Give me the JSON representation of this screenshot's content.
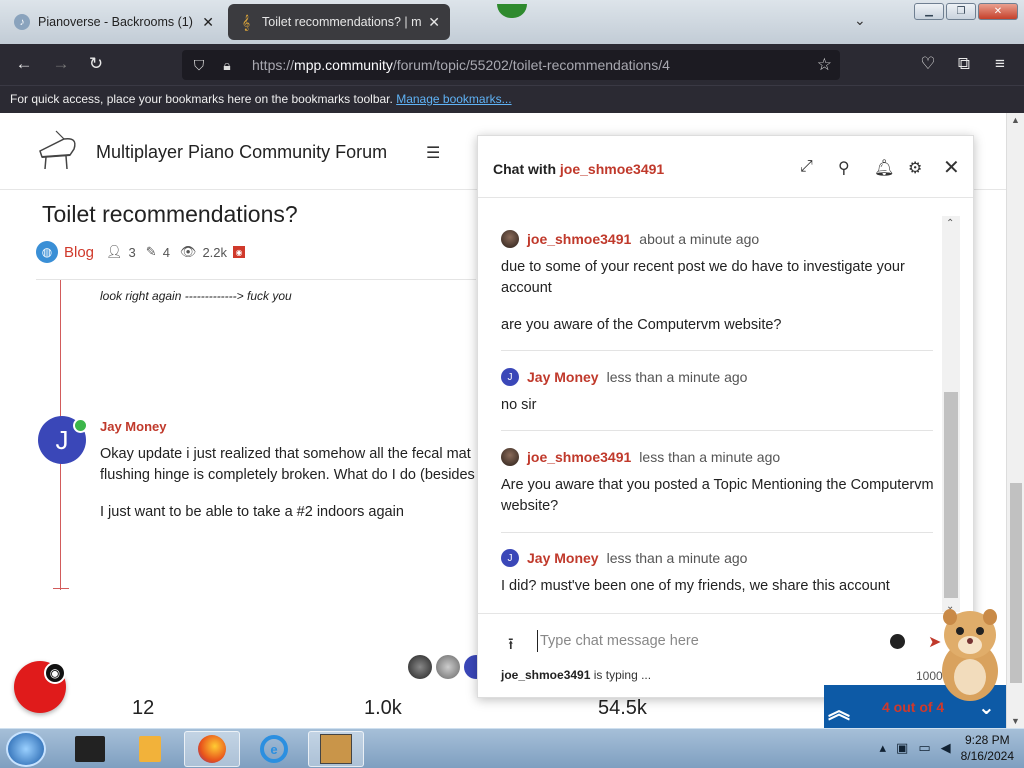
{
  "browser": {
    "tabs": [
      {
        "title": "Pianoverse - Backrooms (1)",
        "active": false
      },
      {
        "title": "Toilet recommendations? | mpp",
        "active": true
      }
    ],
    "url_prefix": "https://",
    "url_host": "mpp.community",
    "url_path": "/forum/topic/55202/toilet-recommendations/4",
    "bookmarks_text": "For quick access, place your bookmarks here on the bookmarks toolbar.",
    "bookmarks_link": "Manage bookmarks..."
  },
  "forum": {
    "site_title": "Multiplayer Piano Community Forum",
    "topic_title": "Toilet recommendations?",
    "category": "Blog",
    "posters": "3",
    "posts": "4",
    "views": "2.2k",
    "quote_text": "look right again -------------> fuck you",
    "post": {
      "author": "Jay Money",
      "avatar_letter": "J",
      "paragraphs": [
        "Okay update i just realized that somehow all the fecal mat",
        "flushing hinge is completely broken. What do I do (besides",
        "I just want to be able to take a #2 indoors again"
      ]
    },
    "stats": [
      "12",
      "1.0k",
      "54.5k"
    ],
    "pager_text": "4 out of 4"
  },
  "chat": {
    "title_prefix": "Chat with",
    "title_user": "joe_shmoe3491",
    "messages": [
      {
        "user": "joe_shmoe3491",
        "time": "about a minute ago",
        "paragraphs": [
          "due to some of your recent post we do have to investigate your account",
          "are you aware of the Computervm website?"
        ]
      },
      {
        "user": "Jay Money",
        "time": "less than a minute ago",
        "paragraphs": [
          "no sir"
        ]
      },
      {
        "user": "joe_shmoe3491",
        "time": "less than a minute ago",
        "paragraphs": [
          "Are you aware that you posted a Topic Mentioning the Computervm website?"
        ]
      },
      {
        "user": "Jay Money",
        "time": "less than a minute ago",
        "paragraphs": [
          "I did? must've been one of my friends, we share this account"
        ]
      }
    ],
    "input_placeholder": "Type chat message here",
    "typing_user": "joe_shmoe3491",
    "typing_suffix": "is typing ...",
    "char_limit": "1000"
  },
  "taskbar": {
    "time": "9:28 PM",
    "date": "8/16/2024"
  },
  "colors": {
    "accent_red": "#c0392b",
    "jay_avatar": "#3a47b8",
    "pager_blue": "#0d5aa6"
  }
}
